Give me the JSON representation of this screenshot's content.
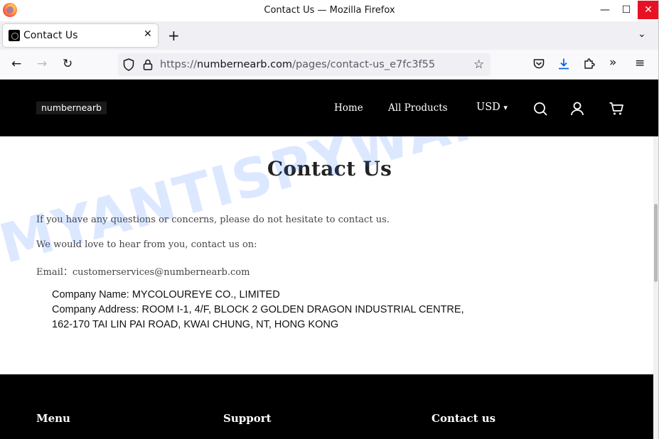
{
  "window": {
    "title": "Contact Us — Mozilla Firefox",
    "controls": {
      "minimize": "—",
      "maximize": "☐",
      "close": "✕"
    }
  },
  "tabs": [
    {
      "label": "Contact Us",
      "close": "✕"
    }
  ],
  "tabbar": {
    "new_tab": "+",
    "list_all": "⌄"
  },
  "navigation": {
    "back": "←",
    "forward": "→",
    "reload": "↻",
    "url_scheme": "https://",
    "url_host": "numbernearb.com",
    "url_path": "/pages/contact-us_e7fc3f55",
    "bookmark": "☆",
    "overflow": "»",
    "menu": "≡"
  },
  "site": {
    "logo": "numbernearb",
    "menu": [
      "Home",
      "All Products"
    ],
    "currency": "USD",
    "currency_caret": "▾"
  },
  "content": {
    "title": "Contact Us",
    "paragraphs": [
      "If you have any questions or concerns, please do not hesitate to contact us.",
      "We would love to hear from you, contact us on:",
      "Email：customerservices@numbernearb.com"
    ],
    "company_lines": [
      "Company Name: MYCOLOUREYE CO., LIMITED",
      "Company Address: ROOM I-1, 4/F, BLOCK 2 GOLDEN DRAGON INDUSTRIAL CENTRE,",
      "162-170 TAI LIN PAI ROAD, KWAI CHUNG, NT, HONG KONG"
    ]
  },
  "watermark": "MYANTISPYWARE.COM",
  "footer": {
    "headings": [
      "Menu",
      "Support",
      "Contact us"
    ]
  },
  "colors": {
    "header_bg": "#000000",
    "watermark": "#286eff",
    "close_button": "#e81123",
    "download_icon": "#0060df"
  },
  "icons": {
    "titlebar": "firefox-logo-icon",
    "url": [
      "tracking-shield-icon",
      "padlock-icon",
      "bookmark-star-icon"
    ],
    "toolbar": [
      "pocket-icon",
      "downloads-icon",
      "extensions-icon",
      "overflow-icon",
      "hamburger-menu-icon"
    ],
    "site_header": [
      "search-icon",
      "account-icon",
      "cart-icon"
    ]
  }
}
